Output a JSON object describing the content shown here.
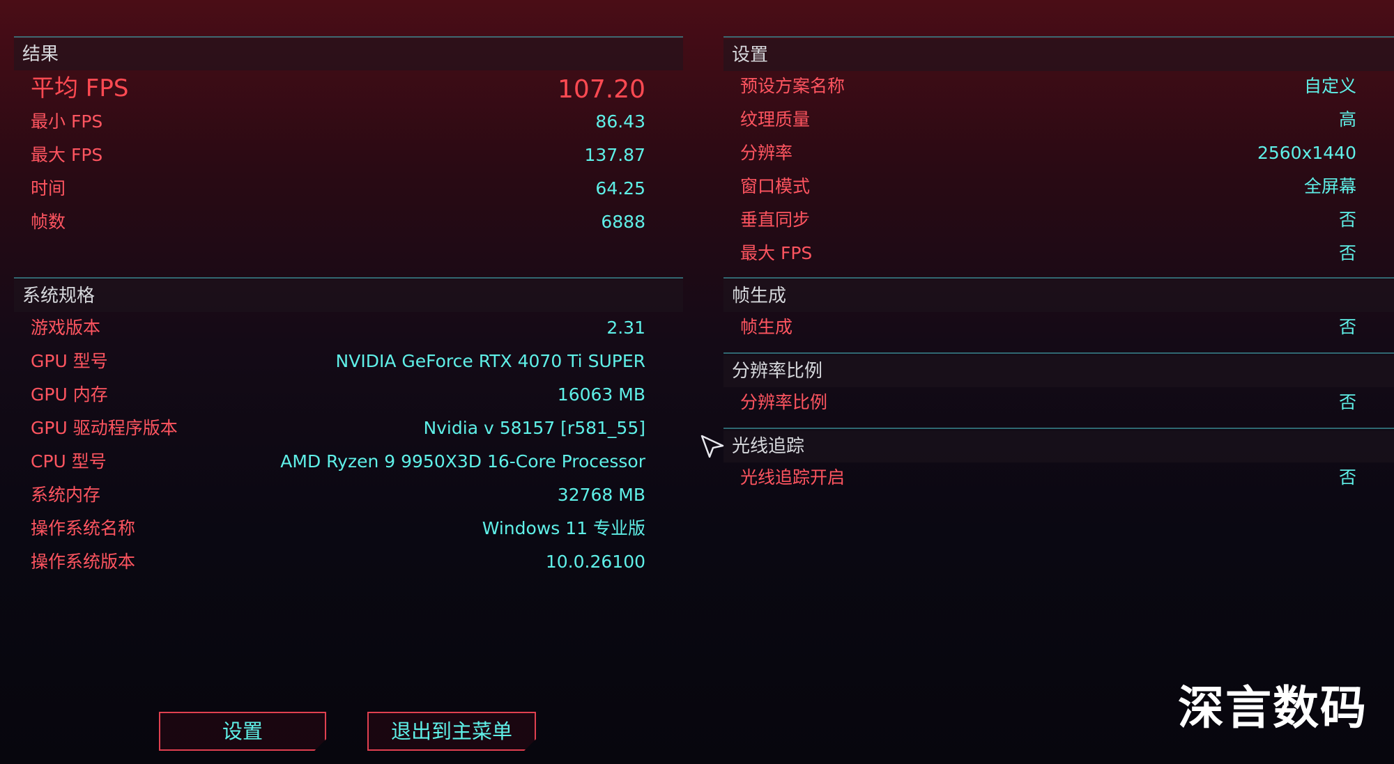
{
  "results": {
    "title": "结果",
    "rows": [
      {
        "label": "平均 FPS",
        "value": "107.20"
      },
      {
        "label": "最小 FPS",
        "value": "86.43"
      },
      {
        "label": "最大 FPS",
        "value": "137.87"
      },
      {
        "label": "时间",
        "value": "64.25"
      },
      {
        "label": "帧数",
        "value": "6888"
      }
    ]
  },
  "system": {
    "title": "系统规格",
    "rows": [
      {
        "label": "游戏版本",
        "value": "2.31"
      },
      {
        "label": "GPU 型号",
        "value": "NVIDIA GeForce RTX 4070 Ti SUPER"
      },
      {
        "label": "GPU 内存",
        "value": "16063 MB"
      },
      {
        "label": "GPU 驱动程序版本",
        "value": "Nvidia v 58157 [r581_55]"
      },
      {
        "label": "CPU 型号",
        "value": "AMD Ryzen 9 9950X3D 16-Core Processor"
      },
      {
        "label": "系统内存",
        "value": "32768 MB"
      },
      {
        "label": "操作系统名称",
        "value": "Windows 11 专业版"
      },
      {
        "label": "操作系统版本",
        "value": "10.0.26100"
      }
    ]
  },
  "settings": {
    "title": "设置",
    "rows": [
      {
        "label": "预设方案名称",
        "value": "自定义"
      },
      {
        "label": "纹理质量",
        "value": "高"
      },
      {
        "label": "分辨率",
        "value": "2560x1440"
      },
      {
        "label": "窗口模式",
        "value": "全屏幕"
      },
      {
        "label": "垂直同步",
        "value": "否"
      },
      {
        "label": "最大 FPS",
        "value": "否"
      }
    ]
  },
  "frame_gen": {
    "title": "帧生成",
    "rows": [
      {
        "label": "帧生成",
        "value": "否"
      }
    ]
  },
  "res_scale": {
    "title": "分辨率比例",
    "rows": [
      {
        "label": "分辨率比例",
        "value": "否"
      }
    ]
  },
  "ray_tracing": {
    "title": "光线追踪",
    "rows": [
      {
        "label": "光线追踪开启",
        "value": "否"
      }
    ]
  },
  "buttons": {
    "settings": "设置",
    "exit": "退出到主菜单"
  },
  "watermark": "深言数码",
  "icons": {
    "cursor": "arrow-cursor-icon"
  },
  "colors": {
    "label": "#ff5560",
    "value": "#5ff0e8",
    "divider": "#3a8a92",
    "heading": "#d6d8dc"
  }
}
